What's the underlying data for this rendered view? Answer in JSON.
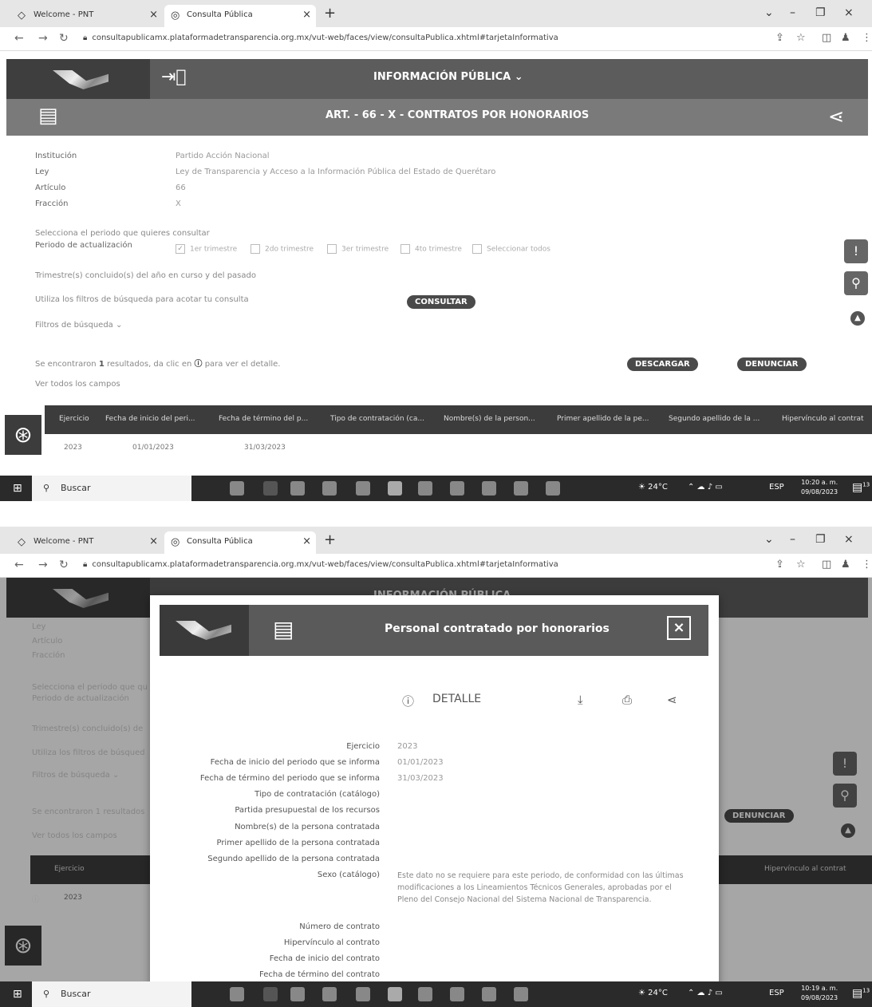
{
  "browser": {
    "tabs": [
      {
        "label": "Welcome - PNT",
        "close": "×"
      },
      {
        "label": "Consulta Pública",
        "close": "×"
      }
    ],
    "new_tab": "+",
    "url": "consultapublicamx.plataformadetransparencia.org.mx/vut-web/faces/view/consultaPublica.xhtml#tarjetaInformativa",
    "win_controls": [
      "⌄",
      "–",
      "❐",
      "×"
    ]
  },
  "app": {
    "menu_title": "INFORMACIÓN PÚBLICA ⌄",
    "article_title": "ART. - 66 - X - CONTRATOS POR HONORARIOS",
    "fields": [
      {
        "label": "Institución",
        "value": "Partido Acción Nacional"
      },
      {
        "label": "Ley",
        "value": "Ley de Transparencia y Acceso a la Información Pública del Estado de Querétaro"
      },
      {
        "label": "Artículo",
        "value": "66"
      },
      {
        "label": "Fracción",
        "value": "X"
      }
    ],
    "period_hint": "Selecciona el periodo que quieres consultar",
    "period_label": "Periodo de actualización",
    "periods": [
      "1er trimestre",
      "2do trimestre",
      "3er trimestre",
      "4to trimestre",
      "Seleccionar todos"
    ],
    "quarters_note": "Trimestre(s) concluido(s) del año en curso y del pasado",
    "filters_hint": "Utiliza los filtros de búsqueda para acotar tu consulta",
    "consultar": "CONSULTAR",
    "filters": "Filtros de búsqueda ⌄",
    "results_a": "Se encontraron",
    "results_count": "1",
    "results_b": "resultados, da clic en",
    "results_c": "para ver el detalle.",
    "descargar": "DESCARGAR",
    "denunciar": "DENUNCIAR",
    "ver_todos": "Ver todos los campos",
    "columns": [
      "Ejercicio",
      "Fecha de inicio del peri...",
      "Fecha de término del p...",
      "Tipo de contratación (ca...",
      "Nombre(s) de la person...",
      "Primer apellido de la pe...",
      "Segundo apellido de la ...",
      "Hipervínculo al contrat"
    ],
    "row": [
      "2023",
      "01/01/2023",
      "31/03/2023"
    ]
  },
  "taskbar": {
    "search": "Buscar",
    "temp": "24°C",
    "lang": "ESP",
    "time1": "10:20 a. m.",
    "date1": "09/08/2023",
    "time2": "10:19 a. m.",
    "date2": "09/08/2023",
    "notif_count": "13"
  },
  "modal": {
    "title": "Personal contratado por honorarios",
    "close": "×",
    "detail": "DETALLE",
    "labels": [
      "Ejercicio",
      "Fecha de inicio del periodo que se informa",
      "Fecha de término del periodo que se informa",
      "Tipo de contratación (catálogo)",
      "Partida presupuestal de los recursos",
      "Nombre(s) de la persona contratada",
      "Primer apellido de la persona contratada",
      "Segundo apellido de la persona contratada",
      "Sexo (catálogo)",
      "Número de contrato",
      "Hipervínculo al contrato",
      "Fecha de inicio del contrato",
      "Fecha de término del contrato"
    ],
    "values": [
      "2023",
      "01/01/2023",
      "31/03/2023"
    ],
    "note": "Este dato no se requiere para este periodo, de conformidad con las últimas modificaciones a los Lineamientos Técnicos Generales, aprobadas por el Pleno del Consejo Nacional del Sistema Nacional de Transparencia."
  }
}
